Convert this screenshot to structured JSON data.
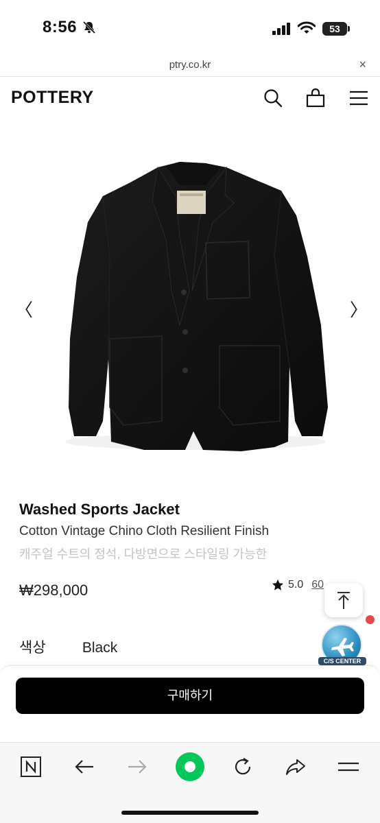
{
  "status_bar": {
    "time": "8:56",
    "battery": "53"
  },
  "browser": {
    "url": "ptry.co.kr",
    "close_label": "×"
  },
  "header": {
    "logo": "POTTERY"
  },
  "gallery": {
    "prev_label": "〈",
    "next_label": "〉"
  },
  "product": {
    "name": "Washed Sports Jacket",
    "subtitle": "Cotton Vintage Chino Cloth Resilient Finish",
    "description": "캐주얼 수트의 정석, 다방면으로 스타일링 가능한",
    "price": "₩298,000",
    "rating": "5.0",
    "review_count": "60"
  },
  "option": {
    "label": "색상",
    "value": "Black"
  },
  "cs_center": {
    "label": "C/S CENTER"
  },
  "buy": {
    "label": "구매하기"
  },
  "icons": {
    "header": [
      "search-icon",
      "cart-icon",
      "menu-icon"
    ],
    "browser_bar": [
      "naver-icon",
      "back-icon",
      "forward-icon",
      "green-dot-icon",
      "refresh-icon",
      "share-icon",
      "menu-icon"
    ]
  },
  "colors": {
    "brand_green": "#03c75a",
    "badge_red": "#e5484d",
    "button_black": "#000000"
  }
}
